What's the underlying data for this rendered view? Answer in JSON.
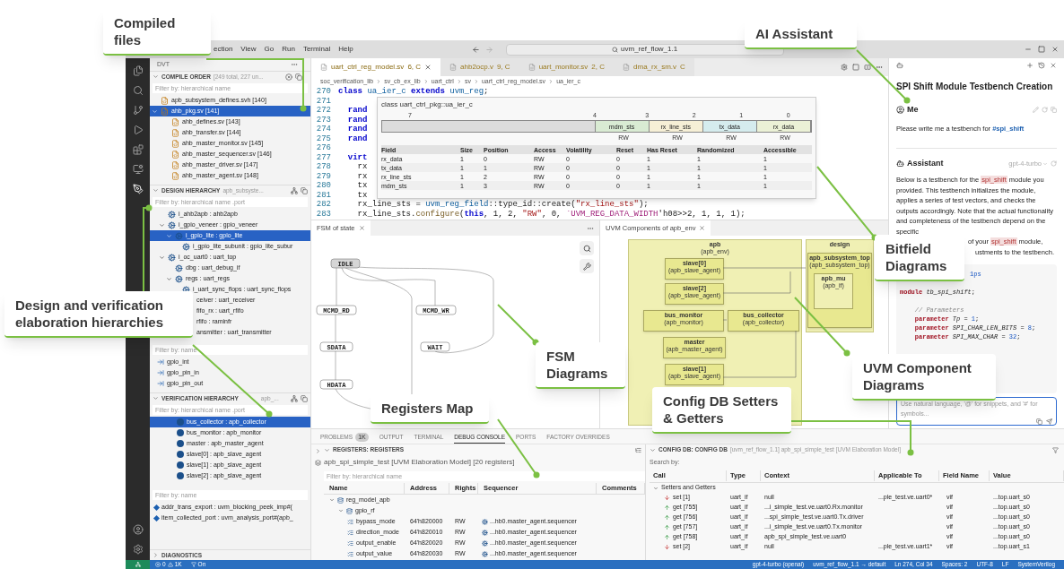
{
  "callouts": [
    {
      "text": "Compiled files"
    },
    {
      "text": "AI Assistant"
    },
    {
      "text": "Design and verification elaboration hierarchies"
    },
    {
      "text": "Bitfield Diagrams"
    },
    {
      "text": "FSM Diagrams"
    },
    {
      "text": "UVM Component Diagrams"
    },
    {
      "text": "Registers Map"
    },
    {
      "text": "Config DB Setters & Getters"
    }
  ],
  "menu": [
    "ection",
    "View",
    "Go",
    "Run",
    "Terminal",
    "Help"
  ],
  "command_center": "uvm_ref_flow_1.1",
  "sidebar": {
    "title": "DVT",
    "compile_order": {
      "title": "COMPILE ORDER",
      "info": "[249 total, 227 un...",
      "filter": "Filter by: hierarchical name",
      "items": [
        {
          "label": "apb_subsystem_defines.svh [140]",
          "kind": "file",
          "selected": false
        },
        {
          "label": "ahb_pkg.sv [141]",
          "kind": "file",
          "selected": true,
          "expanded": true,
          "children": [
            {
              "label": "ahb_defines.sv [143]",
              "kind": "file",
              "selected": false
            },
            {
              "label": "ahb_transfer.sv [144]",
              "kind": "file",
              "selected": false
            },
            {
              "label": "ahb_master_monitor.sv [145]",
              "kind": "file",
              "selected": false
            },
            {
              "label": "ahb_master_sequencer.sv [146]",
              "kind": "file",
              "selected": false
            },
            {
              "label": "ahb_master_driver.sv [147]",
              "kind": "file",
              "selected": false
            },
            {
              "label": "ahb_master_agent.sv [148]",
              "kind": "file",
              "selected": false
            }
          ]
        }
      ]
    },
    "design_hierarchy": {
      "title": "DESIGN HIERARCHY",
      "info": "apb_subsyste...",
      "filter": "Filter by: hierarchical name .port",
      "items": [
        {
          "label": "i_ahb2apb : ahb2apb",
          "kind": "module",
          "selected": false
        },
        {
          "label": "i_gpio_veneer : gpio_veneer",
          "kind": "module",
          "selected": false,
          "expanded": true,
          "children": [
            {
              "label": "i_gpio_lite : gpio_lite",
              "kind": "module",
              "selected": true,
              "expanded": true,
              "children": [
                {
                  "label": "i_gpio_lite_subunit : gpio_lite_subur",
                  "kind": "module",
                  "selected": false
                }
              ]
            }
          ]
        },
        {
          "label": "i_oc_uart0 : uart_top",
          "kind": "module",
          "selected": false,
          "expanded": true,
          "children": [
            {
              "label": "dbg : uart_debug_if",
              "kind": "module",
              "selected": false
            },
            {
              "label": "regs : uart_regs",
              "kind": "module",
              "selected": false,
              "expanded": true,
              "children": [
                {
                  "label": "i_uart_sync_flops : uart_sync_flops",
                  "kind": "module",
                  "selected": false
                },
                {
                  "label": "ceiver : uart_receiver",
                  "kind": "partial",
                  "selected": false
                },
                {
                  "label": "fifo_rx : uart_rfifo",
                  "kind": "partial",
                  "selected": false
                },
                {
                  "label": "rfifo : raminfr",
                  "kind": "partial",
                  "selected": false
                },
                {
                  "label": "ansmitter : uart_transmitter",
                  "kind": "partial",
                  "selected": false
                }
              ]
            }
          ]
        }
      ],
      "port_filter": "Filter by: name",
      "ports": [
        "gpio_int",
        "gpio_pin_in",
        "gpio_pin_out"
      ]
    },
    "verification_hierarchy": {
      "title": "VERIFICATION HIERARCHY",
      "info": "apb_...",
      "filter": "Filter by: hierarchical name .port",
      "items": [
        {
          "label": "bus_collector : apb_collector",
          "kind": "component",
          "selected": true
        },
        {
          "label": "bus_monitor : apb_monitor",
          "kind": "component",
          "selected": false
        },
        {
          "label": "master : apb_master_agent",
          "kind": "component",
          "selected": false
        },
        {
          "label": "slave[0] : apb_slave_agent",
          "kind": "component",
          "selected": false
        },
        {
          "label": "slave[1] : apb_slave_agent",
          "kind": "component",
          "selected": false
        },
        {
          "label": "slave[2] : apb_slave_agent",
          "kind": "component",
          "selected": false
        }
      ],
      "port_filter": "Filter by: name",
      "ports": [
        "addr_trans_export : uvm_blocking_peek_imp#(",
        "item_collected_port : uvm_analysis_port#(apb_"
      ]
    },
    "diagnostics": "DIAGNOSTICS"
  },
  "editor": {
    "tabs": [
      {
        "label": "uart_ctrl_reg_model.sv",
        "badge": "6, C",
        "selected": true
      },
      {
        "label": "ahb2ocp.v",
        "badge": "9, C",
        "selected": false
      },
      {
        "label": "uart_monitor.sv",
        "badge": "2, C",
        "selected": false
      },
      {
        "label": "dma_rx_sm.v",
        "badge": "C",
        "selected": false
      }
    ],
    "breadcrumb": [
      "soc_verification_lib",
      "sv_cb_ex_lib",
      "uart_ctrl",
      "sv",
      "uart_ctrl_reg_model.sv",
      "ua_ier_c"
    ],
    "lines": [
      {
        "num": "270",
        "parts": [
          {
            "text": "class ",
            "kind": "kw"
          },
          {
            "text": "ua_ier_c",
            "kind": "type"
          },
          {
            "text": " extends ",
            "kind": "kw"
          },
          {
            "text": "uvm_reg",
            "kind": "type"
          },
          {
            "text": ";",
            "kind": "plain"
          }
        ]
      },
      {
        "num": "271"
      },
      {
        "num": "272",
        "parts": [
          {
            "text": "  rand",
            "kind": "kw"
          }
        ]
      },
      {
        "num": "273",
        "parts": [
          {
            "text": "  rand",
            "kind": "kw"
          }
        ]
      },
      {
        "num": "274",
        "parts": [
          {
            "text": "  rand",
            "kind": "kw"
          }
        ]
      },
      {
        "num": "275",
        "parts": [
          {
            "text": "  rand",
            "kind": "kw"
          }
        ]
      },
      {
        "num": "276"
      },
      {
        "num": "277",
        "parts": [
          {
            "text": "  virt",
            "kind": "kw"
          }
        ]
      },
      {
        "num": "278",
        "parts": [
          {
            "text": "    rx",
            "kind": "plain"
          }
        ]
      },
      {
        "num": "279",
        "parts": [
          {
            "text": "    rx",
            "kind": "plain"
          }
        ]
      },
      {
        "num": "280",
        "parts": [
          {
            "text": "    tx",
            "kind": "plain"
          }
        ]
      },
      {
        "num": "281",
        "parts": [
          {
            "text": "    tx",
            "kind": "plain"
          }
        ]
      },
      {
        "num": "282",
        "parts": [
          {
            "text": "    rx_line_sts = ",
            "kind": "plain"
          },
          {
            "text": "uvm_reg_field",
            "kind": "type"
          },
          {
            "text": "::type_id::create(",
            "kind": "plain"
          },
          {
            "text": "\"rx_line_sts\"",
            "kind": "str"
          },
          {
            "text": ");",
            "kind": "plain"
          }
        ]
      },
      {
        "num": "283",
        "parts": [
          {
            "text": "    rx_line_sts.",
            "kind": "plain"
          },
          {
            "text": "configure",
            "kind": "fn"
          },
          {
            "text": "(",
            "kind": "plain"
          },
          {
            "text": "this",
            "kind": "kw"
          },
          {
            "text": ", 1, 2, ",
            "kind": "plain"
          },
          {
            "text": "\"RW\"",
            "kind": "str"
          },
          {
            "text": ", 0, ",
            "kind": "plain"
          },
          {
            "text": "`UVM_REG_DATA_WIDTH",
            "kind": "macro"
          },
          {
            "text": "'h08>>2, 1, 1, 1);",
            "kind": "plain"
          }
        ]
      }
    ],
    "hover": {
      "title": "class uart_ctrl_pkg::ua_ier_c",
      "reserved": {
        "high": "7",
        "low": "4"
      },
      "fields": [
        {
          "name": "mdm_sts",
          "bit": "3",
          "access": "RW",
          "color": "#d9ebd3"
        },
        {
          "name": "rx_line_sts",
          "bit": "2",
          "access": "RW",
          "color": "#f6efd6"
        },
        {
          "name": "tx_data",
          "bit": "1",
          "access": "RW",
          "color": "#d5ecee"
        },
        {
          "name": "rx_data",
          "bit": "0",
          "access": "RW",
          "color": "#ebf1d6"
        }
      ],
      "columns": [
        "Field",
        "Size",
        "Position",
        "Access",
        "Volatility",
        "Reset",
        "Has Reset",
        "Randomized",
        "Accessible"
      ],
      "rows": [
        [
          "rx_data",
          "1",
          "0",
          "RW",
          "0",
          "0",
          "1",
          "1",
          "1"
        ],
        [
          "tx_data",
          "1",
          "1",
          "RW",
          "0",
          "0",
          "1",
          "1",
          "1"
        ],
        [
          "rx_line_sts",
          "1",
          "2",
          "RW",
          "0",
          "0",
          "1",
          "1",
          "1"
        ],
        [
          "mdm_sts",
          "1",
          "3",
          "RW",
          "0",
          "0",
          "1",
          "1",
          "1"
        ]
      ]
    }
  },
  "fsm": {
    "tab": "FSM of state",
    "states": [
      {
        "name": "IDLE",
        "kind": "initial"
      },
      {
        "name": "MCMD_RD",
        "kind": "state"
      },
      {
        "name": "MCMD_WR",
        "kind": "state"
      },
      {
        "name": "SDATA",
        "kind": "state"
      },
      {
        "name": "WAIT",
        "kind": "state"
      },
      {
        "name": "HDATA",
        "kind": "state"
      }
    ]
  },
  "uvm": {
    "tab": "UVM Components of apb_env",
    "blocks": [
      {
        "name": "apb",
        "type": "(apb_env)",
        "kind": "env",
        "children": [
          {
            "name": "slave[0]",
            "type": "(apb_slave_agent)",
            "kind": "agent"
          },
          {
            "name": "slave[2]",
            "type": "(apb_slave_agent)",
            "kind": "agent"
          },
          {
            "name": "bus_monitor",
            "type": "(apb_monitor)",
            "kind": "agent"
          },
          {
            "name": "bus_collector",
            "type": "(apb_collector)",
            "kind": "agent"
          },
          {
            "name": "master",
            "type": "(apb_master_agent)",
            "kind": "agent"
          },
          {
            "name": "slave[1]",
            "type": "(apb_slave_agent)",
            "kind": "agent"
          }
        ]
      },
      {
        "name": "design",
        "kind": "env",
        "children": [
          {
            "name": "apb_subsystem_top",
            "type": "(apb_subsystem_top)",
            "kind": "agent",
            "children": [
              {
                "name": "apb_mu",
                "type": "(apb_if)",
                "kind": "inner"
              }
            ]
          }
        ]
      }
    ]
  },
  "chat": {
    "title": "SPI Shift Module Testbench Creation",
    "me": {
      "name": "Me",
      "parts": [
        {
          "text": "Please write me a testbench for ",
          "kind": "text"
        },
        {
          "text": "#spi_shift",
          "kind": "ref"
        }
      ]
    },
    "assistant": {
      "name": "Assistant",
      "model": "gpt-4-turbo",
      "para1": [
        {
          "text": "Below is a testbench for the ",
          "kind": "text"
        },
        {
          "text": "spi_shift",
          "kind": "code"
        },
        {
          "text": " module you provided. This testbench initializes the module, applies a series of test vectors, and checks the outputs accordingly. Note that the actual functionality and completeness of the testbench depend on the specific",
          "kind": "text"
        }
      ],
      "para2": [
        {
          "text": "of your ",
          "kind": "text"
        },
        {
          "text": "spi_shift",
          "kind": "code"
        },
        {
          "text": " module,",
          "kind": "text"
        }
      ],
      "para3": "ustments to the testbench.",
      "code": [
        {
          "kind": "cut",
          "parts": [
            {
              "text": "1ps",
              "kind": "num"
            }
          ]
        },
        {
          "kind": "spaced",
          "parts": [
            {
              "text": "module ",
              "kind": "kw"
            },
            {
              "text": "tb_spi_shift",
              "kind": "name"
            },
            {
              "text": ";",
              "kind": "plain"
            }
          ]
        },
        {
          "kind": "spaced",
          "parts": [
            {
              "text": "    // Parameters",
              "kind": "comment"
            }
          ]
        },
        {
          "kind": "line",
          "parts": [
            {
              "text": "    parameter ",
              "kind": "kw"
            },
            {
              "text": "Tp",
              "kind": "name"
            },
            {
              "text": " = ",
              "kind": "plain"
            },
            {
              "text": "1",
              "kind": "num"
            },
            {
              "text": ";",
              "kind": "plain"
            }
          ]
        },
        {
          "kind": "line",
          "parts": [
            {
              "text": "    parameter ",
              "kind": "kw"
            },
            {
              "text": "SPI_CHAR_LEN_BITS",
              "kind": "name"
            },
            {
              "text": " = ",
              "kind": "plain"
            },
            {
              "text": "8",
              "kind": "num"
            },
            {
              "text": ";",
              "kind": "plain"
            }
          ]
        },
        {
          "kind": "line",
          "parts": [
            {
              "text": "    parameter ",
              "kind": "kw"
            },
            {
              "text": "SPI_MAX_CHAR",
              "kind": "name"
            },
            {
              "text": " = ",
              "kind": "plain"
            },
            {
              "text": "32",
              "kind": "num"
            },
            {
              "text": ";",
              "kind": "plain"
            }
          ]
        }
      ]
    },
    "input_placeholder": "Use natural language, '@' for snippets, and '#' for symbols..."
  },
  "panel": {
    "tabs": [
      {
        "label": "PROBLEMS",
        "badge": "1K",
        "selected": false
      },
      {
        "label": "OUTPUT",
        "selected": false
      },
      {
        "label": "TERMINAL",
        "selected": false
      },
      {
        "label": "DEBUG CONSOLE",
        "selected": true
      },
      {
        "label": "PORTS",
        "selected": false
      },
      {
        "label": "FACTORY OVERRIDES",
        "selected": false
      }
    ]
  },
  "registers": {
    "header": "REGISTERS: REGISTERS",
    "title": "apb_spi_simple_test [UVM Elaboration Model] [20 registers]",
    "filter": "Filter by: hierarchical name",
    "columns": [
      "Name",
      "Address",
      "Rights",
      "Sequencer",
      "Comments"
    ],
    "rows": [
      {
        "name": "reg_model_apb",
        "kind": "map",
        "expanded": true,
        "children": [
          {
            "name": "gpio_rf",
            "kind": "map",
            "expanded": true,
            "children": [
              {
                "name": "bypass_mode",
                "kind": "reg",
                "address": "64'h820000",
                "rights": "RW",
                "sequencer": "...hb0.master_agent.sequencer"
              },
              {
                "name": "direction_mode",
                "kind": "reg",
                "address": "64'h820010",
                "rights": "RW",
                "sequencer": "...hb0.master_agent.sequencer"
              },
              {
                "name": "output_enable",
                "kind": "reg",
                "address": "64'h820020",
                "rights": "RW",
                "sequencer": "...hb0.master_agent.sequencer"
              },
              {
                "name": "output_value",
                "kind": "reg",
                "address": "64'h820030",
                "rights": "RW",
                "sequencer": "...hb0.master_agent.sequencer"
              }
            ]
          }
        ]
      }
    ]
  },
  "config_db": {
    "header": "CONFIG DB: CONFIG DB",
    "info": "[uvm_ref_flow_1.1] apb_spi_simple_test [UVM Elaboration Model]",
    "search": "Search by:",
    "columns": [
      "Call",
      "Type",
      "Context",
      "Applicable To",
      "Field Name",
      "Value"
    ],
    "group": {
      "label": "Setters and Getters",
      "expanded": true
    },
    "rows": [
      {
        "call": "set [1]",
        "kind": "set",
        "type": "uart_if",
        "context": "null",
        "applicable": "...ple_test.ve.uart0*",
        "field": "vif",
        "value": "...top.uart_s0"
      },
      {
        "call": "get [755]",
        "kind": "get",
        "type": "uart_if",
        "context": "...i_simple_test.ve.uart0.Rx.monitor",
        "field": "vif",
        "value": "...top.uart_s0"
      },
      {
        "call": "get [756]",
        "kind": "get",
        "type": "uart_if",
        "context": "...spi_simple_test.ve.uart0.Tx.driver",
        "field": "vif",
        "value": "...top.uart_s0"
      },
      {
        "call": "get [757]",
        "kind": "get",
        "type": "uart_if",
        "context": "...i_simple_test.ve.uart0.Tx.monitor",
        "field": "vif",
        "value": "...top.uart_s0"
      },
      {
        "call": "get [758]",
        "kind": "get",
        "type": "uart_if",
        "context": "apb_spi_simple_test.ve.uart0",
        "field": "vif",
        "value": "...top.uart_s0"
      },
      {
        "call": "set [2]",
        "kind": "set",
        "type": "uart_if",
        "context": "null",
        "applicable": "...ple_test.ve.uart1*",
        "field": "vif",
        "value": "...top.uart_s1"
      }
    ]
  },
  "status": {
    "errors": "0",
    "warnings": "1K",
    "filter": "On",
    "right": [
      "gpt-4-turbo (openai)",
      "uvm_ref_flow_1.1 → default",
      "Ln 274, Col 34",
      "Spaces: 2",
      "UTF-8",
      "LF",
      "SystemVerilog"
    ]
  }
}
